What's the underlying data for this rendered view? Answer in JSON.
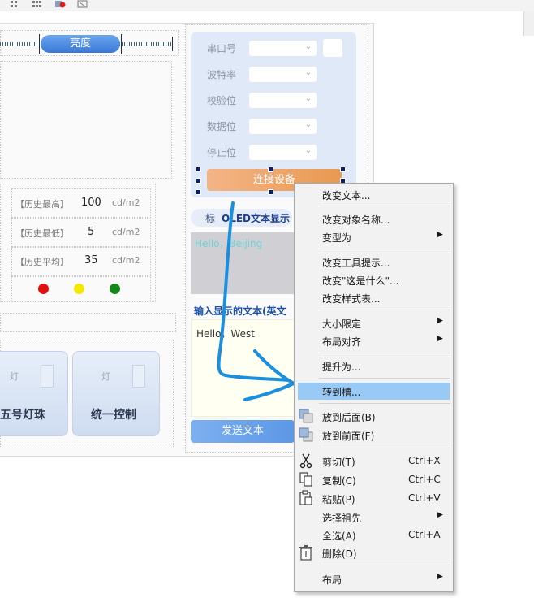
{
  "brightness": {
    "label": "亮度"
  },
  "serial": {
    "rows": [
      {
        "label": "串口号",
        "value": ""
      },
      {
        "label": "波特率",
        "value": ""
      },
      {
        "label": "校验位",
        "value": ""
      },
      {
        "label": "数据位",
        "value": ""
      },
      {
        "label": "停止位",
        "value": ""
      }
    ],
    "connect_label": "连接设备"
  },
  "stats": {
    "rows": [
      {
        "label": "【历史最高】",
        "value": "100",
        "unit": "cd/m2"
      },
      {
        "label": "【历史最低】",
        "value": "5",
        "unit": "cd/m2"
      },
      {
        "label": "【历史平均】",
        "value": "35",
        "unit": "cd/m2"
      }
    ],
    "indicator_colors": [
      "#e01010",
      "#f5e800",
      "#138a17"
    ]
  },
  "oled": {
    "tab_prefix": "标",
    "tab_title": "OLED文本显示",
    "display_text": "Hello，Beijing",
    "input_title": "输入显示的文本(英文",
    "input_value": "Hello，West",
    "send_label": "发送文本"
  },
  "lamps": [
    {
      "mini": "灯",
      "name": "五号灯珠"
    },
    {
      "mini": "灯",
      "name": "统一控制"
    }
  ],
  "context_menu": {
    "items": [
      {
        "label": "改变文本...",
        "shortcut": "",
        "submenu": false
      },
      {
        "label": "改变对象名称...",
        "shortcut": "",
        "submenu": false
      },
      {
        "label": "变型为",
        "shortcut": "",
        "submenu": true
      },
      {
        "label": "改变工具提示...",
        "shortcut": "",
        "submenu": false
      },
      {
        "label": "改变\"这是什么\"...",
        "shortcut": "",
        "submenu": false
      },
      {
        "label": "改变样式表...",
        "shortcut": "",
        "submenu": false
      },
      {
        "label": "大小限定",
        "shortcut": "",
        "submenu": true
      },
      {
        "label": "布局对齐",
        "shortcut": "",
        "submenu": true
      },
      {
        "label": "提升为...",
        "shortcut": "",
        "submenu": false
      },
      {
        "label": "转到槽...",
        "shortcut": "",
        "submenu": false
      },
      {
        "label": "放到后面(B)",
        "shortcut": "",
        "submenu": false
      },
      {
        "label": "放到前面(F)",
        "shortcut": "",
        "submenu": false
      },
      {
        "label": "剪切(T)",
        "shortcut": "Ctrl+X",
        "submenu": false
      },
      {
        "label": "复制(C)",
        "shortcut": "Ctrl+C",
        "submenu": false
      },
      {
        "label": "粘贴(P)",
        "shortcut": "Ctrl+V",
        "submenu": false
      },
      {
        "label": "选择祖先",
        "shortcut": "",
        "submenu": true
      },
      {
        "label": "全选(A)",
        "shortcut": "Ctrl+A",
        "submenu": false
      },
      {
        "label": "删除(D)",
        "shortcut": "",
        "submenu": false
      },
      {
        "label": "布局",
        "shortcut": "",
        "submenu": true
      }
    ],
    "highlighted": "转到槽...",
    "highlight_color": "#99c9f5"
  }
}
